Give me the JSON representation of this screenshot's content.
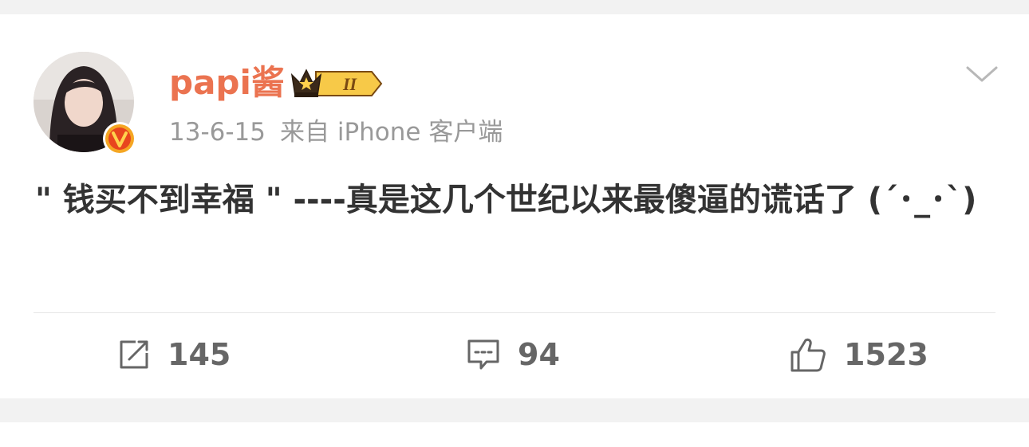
{
  "post": {
    "username": "papi酱",
    "time": "13-6-15",
    "source": "来自 iPhone 客户端",
    "text": "\" 钱买不到幸福 \" ----真是这几个世纪以来最傻逼的谎话了 (´･_･`)",
    "vip_level": "II"
  },
  "actions": {
    "repost_count": "145",
    "comment_count": "94",
    "like_count": "1523"
  },
  "icons": {
    "more": "chevron-down-icon",
    "repost": "repost-icon",
    "comment": "comment-icon",
    "like": "thumbs-up-icon",
    "verified": "verified-v-badge",
    "crown": "crown-vip-icon"
  },
  "colors": {
    "username": "#eb7350",
    "meta": "#999999",
    "text": "#333333",
    "action": "#666666",
    "verified_badge": "#f5a623"
  }
}
